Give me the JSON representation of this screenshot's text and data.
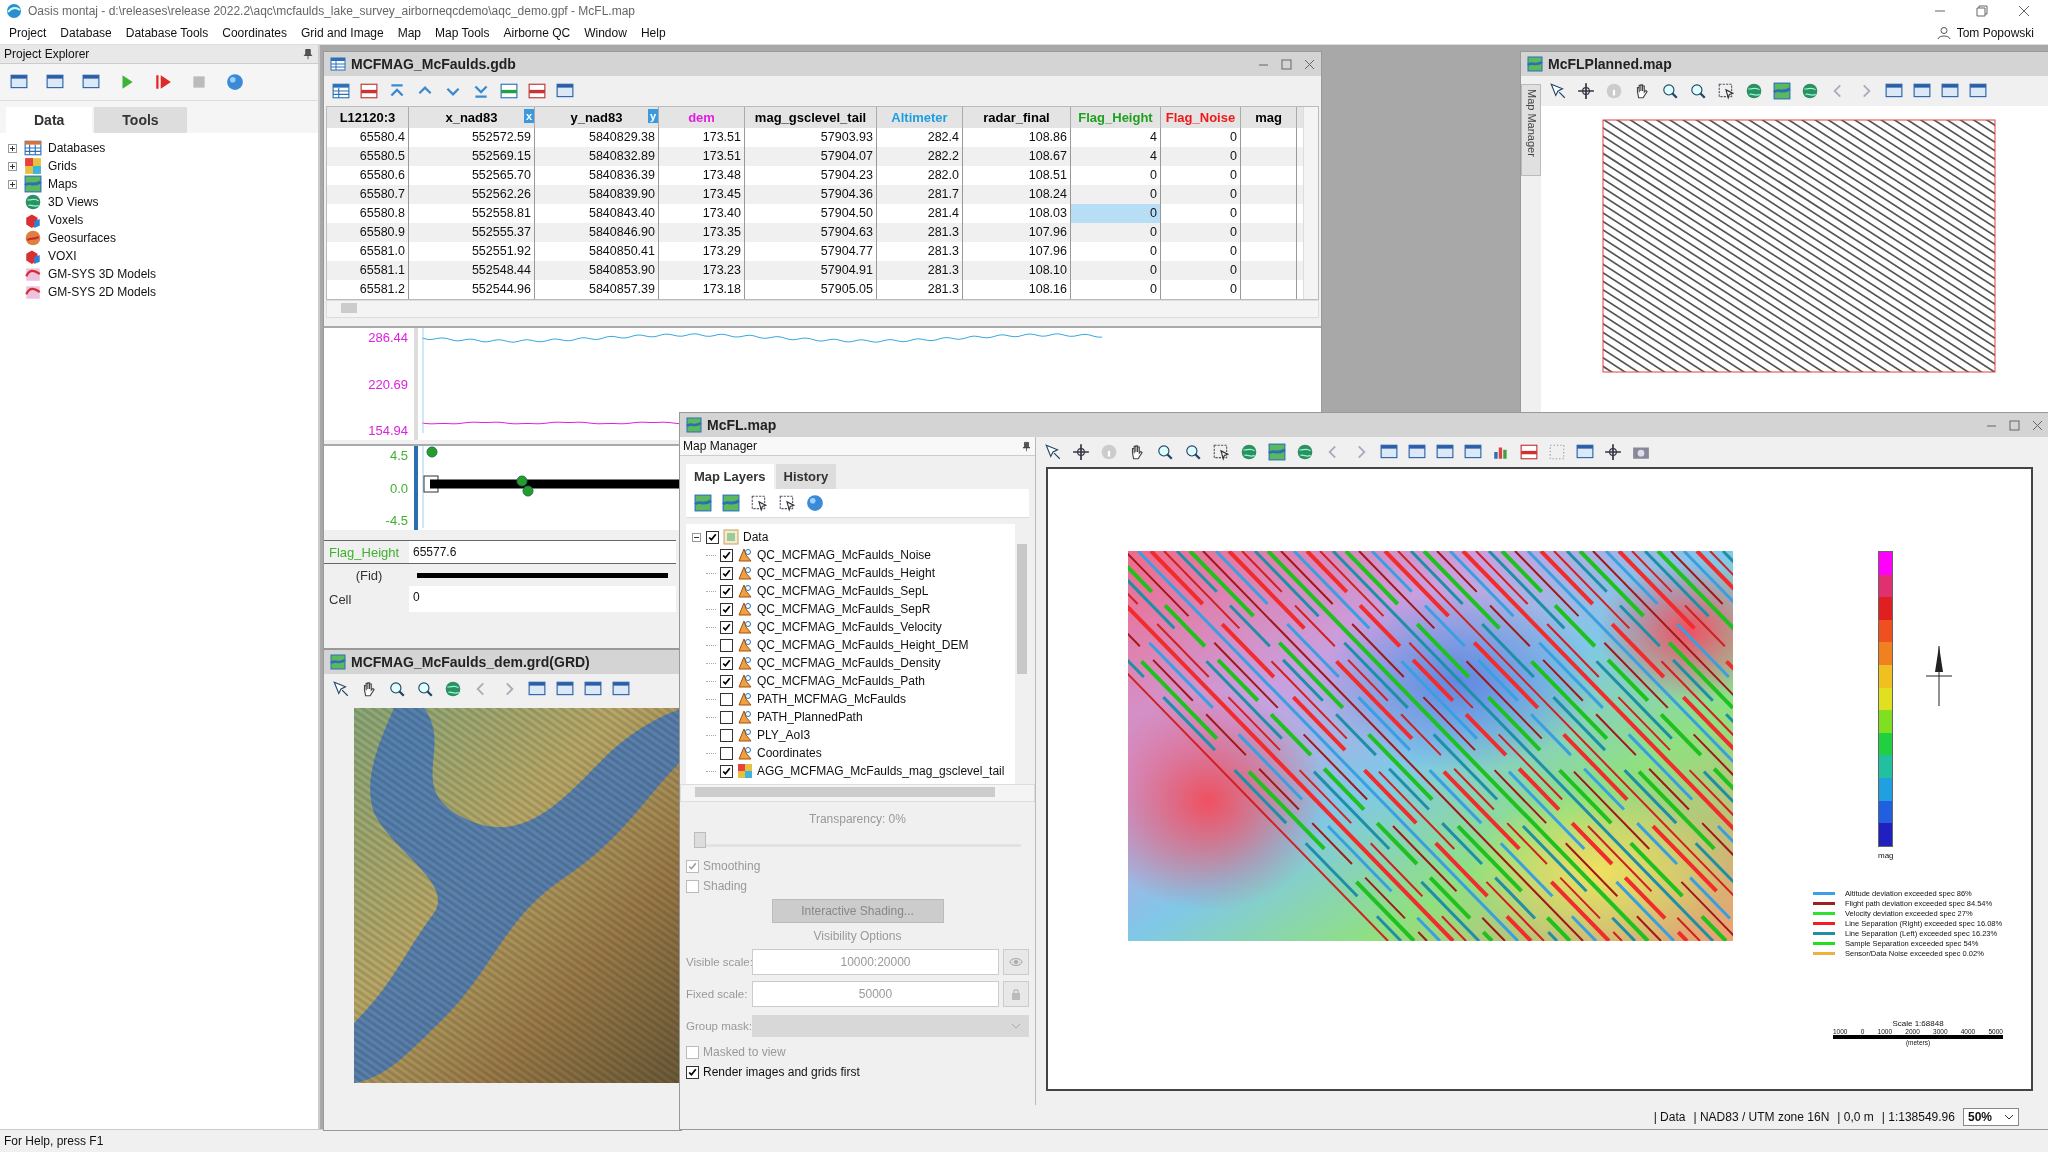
{
  "window": {
    "title": "Oasis montaj - d:\\releases\\release 2022.2\\aqc\\mcfaulds_lake_survey_airborneqcdemo\\aqc_demo.gpf - McFL.map",
    "user": "Tom Popowski"
  },
  "menu": [
    "Project",
    "Database",
    "Database Tools",
    "Coordinates",
    "Grid and Image",
    "Map",
    "Map Tools",
    "Airborne QC",
    "Window",
    "Help"
  ],
  "project_explorer": {
    "title": "Project Explorer",
    "tabs": [
      {
        "label": "Data",
        "selected": true
      },
      {
        "label": "Tools",
        "selected": false
      }
    ],
    "tree": [
      {
        "label": "Databases",
        "kind": "database",
        "expandable": true
      },
      {
        "label": "Grids",
        "kind": "grid",
        "expandable": true
      },
      {
        "label": "Maps",
        "kind": "map",
        "expandable": true
      },
      {
        "label": "3D Views",
        "kind": "globe",
        "expandable": false
      },
      {
        "label": "Voxels",
        "kind": "voxel",
        "expandable": false
      },
      {
        "label": "Geosurfaces",
        "kind": "surface",
        "expandable": false
      },
      {
        "label": "VOXI",
        "kind": "voxel",
        "expandable": false
      },
      {
        "label": "GM-SYS 3D Models",
        "kind": "model",
        "expandable": false
      },
      {
        "label": "GM-SYS 2D Models",
        "kind": "model",
        "expandable": false
      }
    ]
  },
  "database_window": {
    "title": "MCFMAG_McFaulds.gdb",
    "columns": [
      {
        "name": "L12120:3",
        "color": "#000000",
        "selected": false
      },
      {
        "name": "x_nad83",
        "color": "#000000",
        "badge": "x",
        "selected": false
      },
      {
        "name": "y_nad83",
        "color": "#000000",
        "badge": "y",
        "selected": false
      },
      {
        "name": "dem",
        "color": "#e020e0",
        "selected": false
      },
      {
        "name": "mag_gsclevel_tail",
        "color": "#000000",
        "selected": false
      },
      {
        "name": "Altimeter",
        "color": "#1e9ee0",
        "selected": false
      },
      {
        "name": "radar_final",
        "color": "#000000",
        "selected": false
      },
      {
        "name": "Flag_Height",
        "color": "#20a020",
        "selected": true
      },
      {
        "name": "Flag_Noise",
        "color": "#f01818",
        "selected": false
      },
      {
        "name": "mag",
        "color": "#000000",
        "selected": false
      }
    ],
    "rows": [
      {
        "selected": false,
        "cells": [
          "65580.4",
          "552572.59",
          "5840829.38",
          "173.51",
          "57903.93",
          "282.4",
          "108.86",
          "4",
          "0"
        ]
      },
      {
        "selected": false,
        "cells": [
          "65580.5",
          "552569.15",
          "5840832.89",
          "173.51",
          "57904.07",
          "282.2",
          "108.67",
          "4",
          "0"
        ]
      },
      {
        "selected": false,
        "cells": [
          "65580.6",
          "552565.70",
          "5840836.39",
          "173.48",
          "57904.23",
          "282.0",
          "108.51",
          "0",
          "0"
        ]
      },
      {
        "selected": false,
        "cells": [
          "65580.7",
          "552562.26",
          "5840839.90",
          "173.45",
          "57904.36",
          "281.7",
          "108.24",
          "0",
          "0"
        ]
      },
      {
        "selected": true,
        "cells": [
          "65580.8",
          "552558.81",
          "5840843.40",
          "173.40",
          "57904.50",
          "281.4",
          "108.03",
          "0",
          "0"
        ]
      },
      {
        "selected": false,
        "cells": [
          "65580.9",
          "552555.37",
          "5840846.90",
          "173.35",
          "57904.63",
          "281.3",
          "107.96",
          "0",
          "0"
        ]
      },
      {
        "selected": false,
        "cells": [
          "65581.0",
          "552551.92",
          "5840850.41",
          "173.29",
          "57904.77",
          "281.3",
          "107.96",
          "0",
          "0"
        ]
      },
      {
        "selected": false,
        "cells": [
          "65581.1",
          "552548.44",
          "5840853.90",
          "173.23",
          "57904.91",
          "281.3",
          "108.10",
          "0",
          "0"
        ]
      },
      {
        "selected": false,
        "cells": [
          "65581.2",
          "552544.96",
          "5840857.39",
          "173.18",
          "57905.05",
          "281.3",
          "108.16",
          "0",
          "0"
        ]
      }
    ],
    "profile_ticks": [
      "286.44",
      "220.69",
      "154.94"
    ],
    "flag_ticks": [
      "4.5",
      "0.0",
      "-4.5"
    ],
    "fields": [
      {
        "label": "Flag_Height",
        "value": "65577.6",
        "kind": "channel"
      },
      {
        "label": "(Fid)",
        "kind": "bar"
      },
      {
        "label": "Cell",
        "value": "0",
        "kind": "plain"
      }
    ]
  },
  "grid_window": {
    "title": "MCFMAG_McFaulds_dem.grd(GRD)"
  },
  "planned_map_window": {
    "title": "McFLPlanned.map",
    "side_tab": "Map Manager"
  },
  "map_window": {
    "title": "McFL.map",
    "manager": {
      "title": "Map Manager",
      "tabs": [
        {
          "label": "Map Layers",
          "selected": true
        },
        {
          "label": "History",
          "selected": false
        }
      ],
      "group": {
        "label": "Data",
        "checked": true,
        "expanded": true
      },
      "layers": [
        {
          "label": "QC_MCFMAG_McFaulds_Noise",
          "kind": "vector",
          "checked": true
        },
        {
          "label": "QC_MCFMAG_McFaulds_Height",
          "kind": "vector",
          "checked": true
        },
        {
          "label": "QC_MCFMAG_McFaulds_SepL",
          "kind": "vector",
          "checked": true
        },
        {
          "label": "QC_MCFMAG_McFaulds_SepR",
          "kind": "vector",
          "checked": true
        },
        {
          "label": "QC_MCFMAG_McFaulds_Velocity",
          "kind": "vector",
          "checked": true
        },
        {
          "label": "QC_MCFMAG_McFaulds_Height_DEM",
          "kind": "vector",
          "checked": false
        },
        {
          "label": "QC_MCFMAG_McFaulds_Density",
          "kind": "vector",
          "checked": true
        },
        {
          "label": "QC_MCFMAG_McFaulds_Path",
          "kind": "vector",
          "checked": true
        },
        {
          "label": "PATH_MCFMAG_McFaulds",
          "kind": "vector",
          "checked": false
        },
        {
          "label": "PATH_PlannedPath",
          "kind": "vector",
          "checked": false
        },
        {
          "label": "PLY_AoI3",
          "kind": "vector",
          "checked": false
        },
        {
          "label": "Coordinates",
          "kind": "vector",
          "checked": false
        },
        {
          "label": "AGG_MCFMAG_McFaulds_mag_gsclevel_tail",
          "kind": "grid",
          "checked": true
        }
      ],
      "transparency": {
        "label": "Transparency: 0%",
        "level": 0
      },
      "smoothing": {
        "label": "Smoothing",
        "checked": true
      },
      "shading": {
        "label": "Shading",
        "checked": false
      },
      "shading_button": "Interactive Shading...",
      "visibility_title": "Visibility Options",
      "visible_scale": {
        "label": "Visible scale:",
        "value": "10000:20000"
      },
      "fixed_scale": {
        "label": "Fixed scale:",
        "value": "50000"
      },
      "group_mask": {
        "label": "Group mask:"
      },
      "masked": {
        "label": "Masked to view",
        "checked": false
      },
      "render_first": {
        "label": "Render images and grids first",
        "checked": true
      }
    },
    "colorbar_label": "mag",
    "legend": [
      {
        "label": "Altitude deviation exceeded spec 86%",
        "color": "#3aa0e8"
      },
      {
        "label": "Flight path deviation exceeded spec 84.54%",
        "color": "#a02020"
      },
      {
        "label": "Velocity deviation exceeded spec 27%",
        "color": "#30e030"
      },
      {
        "label": "Line Separation (Right) exceeded spec 16.08%",
        "color": "#f02020"
      },
      {
        "label": "Line Separation (Left) exceeded spec 16.23%",
        "color": "#2090a0"
      },
      {
        "label": "Sample Separation exceeded spec 54%",
        "color": "#20e020"
      },
      {
        "label": "Sensor/Data Noise exceeded spec 0.02%",
        "color": "#f0b040"
      }
    ],
    "scale": {
      "title": "Scale 1:68848",
      "ticks": [
        "1000",
        "0",
        "1000",
        "2000",
        "3000",
        "4000",
        "5000"
      ],
      "unit": "(meters)"
    },
    "status": [
      "| Data",
      "| NAD83 / UTM zone 16N",
      "| 0,0 m",
      "| 1:138549.96"
    ],
    "zoom": "50%"
  },
  "status_bar": "For Help, press F1"
}
